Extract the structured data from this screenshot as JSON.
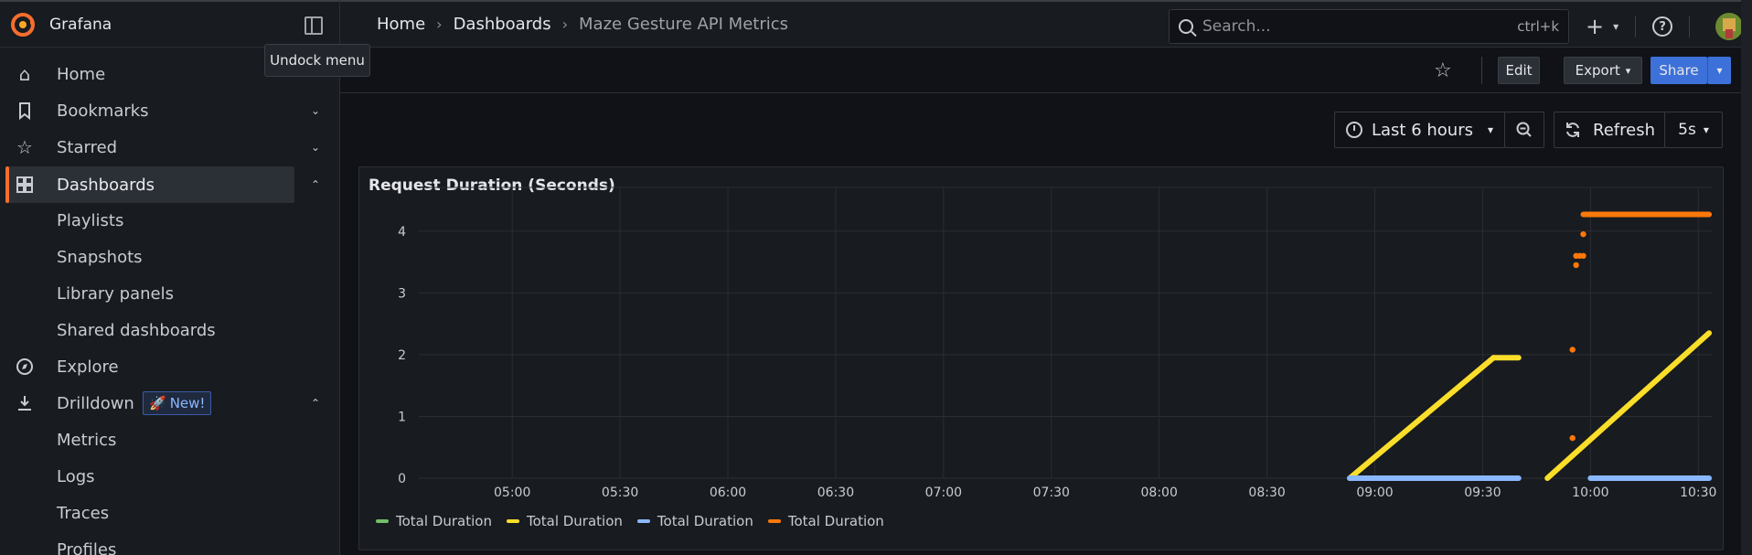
{
  "topbar": {
    "brand": "Grafana",
    "breadcrumb": [
      "Home",
      "Dashboards",
      "Maze Gesture API Metrics"
    ],
    "search_placeholder": "Search...",
    "search_shortcut": "ctrl+k",
    "tooltip": "Undock menu"
  },
  "sidebar": {
    "items": [
      {
        "label": "Home",
        "icon": "home-icon"
      },
      {
        "label": "Bookmarks",
        "icon": "bookmark-icon"
      },
      {
        "label": "Starred",
        "icon": "star-icon"
      },
      {
        "label": "Dashboards",
        "icon": "dashboards-icon"
      },
      {
        "label": "Playlists"
      },
      {
        "label": "Snapshots"
      },
      {
        "label": "Library panels"
      },
      {
        "label": "Shared dashboards"
      },
      {
        "label": "Explore",
        "icon": "compass-icon"
      },
      {
        "label": "Drilldown",
        "icon": "drilldown-icon"
      },
      {
        "label": "Metrics"
      },
      {
        "label": "Logs"
      },
      {
        "label": "Traces"
      },
      {
        "label": "Profiles"
      }
    ],
    "new_badge": "New!"
  },
  "toolbar": {
    "edit_label": "Edit",
    "export_label": "Export",
    "share_label": "Share",
    "time_range": "Last 6 hours",
    "refresh_label": "Refresh",
    "refresh_interval": "5s"
  },
  "colors": {
    "accent": "#f46e2e",
    "share": "#3d71d9",
    "series_green": "#73bf69",
    "series_yellow": "#fade2a",
    "series_blue": "#8ab8ff",
    "series_orange": "#ff780a"
  },
  "chart_data": {
    "type": "scatter",
    "title": "Request Duration (Seconds)",
    "x_ticks": [
      "05:00",
      "05:30",
      "06:00",
      "06:30",
      "07:00",
      "07:30",
      "08:00",
      "08:30",
      "09:00",
      "09:30",
      "10:00",
      "10:30"
    ],
    "y_ticks": [
      0,
      1,
      2,
      3,
      4
    ],
    "ylim": [
      0,
      4.5
    ],
    "xlim": [
      "04:34",
      "10:34"
    ],
    "grid": true,
    "legend": "bottom-left",
    "series": [
      {
        "name": "Total Duration",
        "color": "#73bf69",
        "points": []
      },
      {
        "name": "Total Duration",
        "color": "#fade2a",
        "segments": [
          {
            "from": [
              "08:53",
              0.0
            ],
            "to": [
              "09:33",
              1.95
            ]
          },
          {
            "from": [
              "09:33",
              1.95
            ],
            "to": [
              "09:40",
              1.95
            ]
          },
          {
            "from": [
              "09:48",
              0.0
            ],
            "to": [
              "10:33",
              2.35
            ]
          }
        ]
      },
      {
        "name": "Total Duration",
        "color": "#8ab8ff",
        "segments": [
          {
            "from": [
              "08:53",
              0.0
            ],
            "to": [
              "09:40",
              0.0
            ]
          },
          {
            "from": [
              "10:00",
              0.0
            ],
            "to": [
              "10:33",
              0.0
            ]
          }
        ]
      },
      {
        "name": "Total Duration",
        "color": "#ff780a",
        "points": [
          [
            "09:55",
            0.65
          ],
          [
            "09:55",
            2.08
          ],
          [
            "09:56",
            3.45
          ],
          [
            "09:56",
            3.6
          ],
          [
            "09:57",
            3.6
          ],
          [
            "09:58",
            3.6
          ],
          [
            "09:58",
            3.95
          ]
        ],
        "segments": [
          {
            "from": [
              "09:58",
              4.27
            ],
            "to": [
              "10:33",
              4.27
            ]
          }
        ]
      }
    ]
  }
}
